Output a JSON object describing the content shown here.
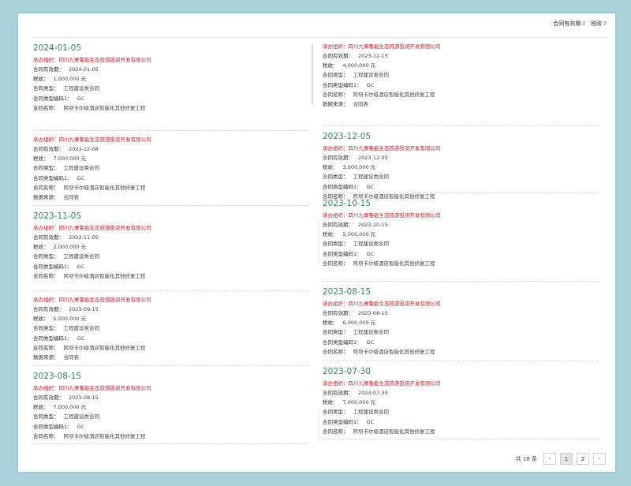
{
  "sort": {
    "items": [
      {
        "label": "合同有效期",
        "arrow": "⇵"
      },
      {
        "label": "税收",
        "arrow": "⇵"
      }
    ]
  },
  "labels": {
    "org": "承办组织：",
    "valid": "合同有效期：",
    "tax": "税收：",
    "type": "合同类型：",
    "code": "合同类型编码1：",
    "name": "合同名称：",
    "source": "数据来源："
  },
  "left": [
    {
      "date": "2024-01-05",
      "org": "四川九寨鲁能生态旅游投资开发有限公司",
      "valid": "2024-01-05",
      "tax": "1,000,000 元",
      "type": "工程建设类合同",
      "code": "GC",
      "name": "阿坝卡尔级酒店智能化其他修复工程",
      "source": ""
    },
    {
      "date": "",
      "org": "四川九寨鲁能生态旅游投资开发有限公司",
      "valid": "2023-12-08",
      "tax": "7,000,000 元",
      "type": "工程建设类合同",
      "code": "GC",
      "name": "阿坝卡尔级酒店智能化其他修复工程",
      "source": "合同表"
    },
    {
      "date": "2023-11-05",
      "org": "四川九寨鲁能生态旅游投资开发有限公司",
      "valid": "2023-11-05",
      "tax": "2,000,000 元",
      "type": "工程建设类合同",
      "code": "GC",
      "name": "阿坝卡尔级酒店智能化其他修复工程",
      "source": ""
    },
    {
      "date": "",
      "org": "四川九寨鲁能生态旅游投资开发有限公司",
      "valid": "2023-09-15",
      "tax": "5,000,000 元",
      "type": "工程建设类合同",
      "code": "GC",
      "name": "阿坝卡尔级酒店智能化其他修复工程",
      "source": "合同表"
    },
    {
      "date": "2023-08-15",
      "org": "四川九寨鲁能生态旅游投资开发有限公司",
      "valid": "2023-08-15",
      "tax": "7,000,000 元",
      "type": "工程建设类合同",
      "code": "GC",
      "name": "阿坝卡尔级酒店智能化其他修复工程",
      "source": ""
    }
  ],
  "right": [
    {
      "date": "",
      "org": "四川九寨鲁能生态旅游投资开发有限公司",
      "valid": "2023-12-15",
      "tax": "4,000,000 元",
      "type": "工程建设类合同",
      "code": "GC",
      "name": "阿坝卡尔级酒店智能化其他修复工程",
      "source": "合同表"
    },
    {
      "date": "2023-12-05",
      "org": "四川九寨鲁能生态旅游投资开发有限公司",
      "valid": "2023-12-05",
      "tax": "3,000,000 元",
      "type": "工程建设类合同",
      "code": "GC",
      "name": "阿坝卡尔级酒店智能化其他修复工程",
      "source": ""
    },
    {
      "date": "2023-10-15",
      "org": "四川九寨鲁能生态旅游投资开发有限公司",
      "valid": "2023-10-15",
      "tax": "5,000,000 元",
      "type": "工程建设类合同",
      "code": "GC",
      "name": "阿坝卡尔级酒店智能化其他修复工程",
      "source": ""
    },
    {
      "date": "2023-08-15",
      "org": "四川九寨鲁能生态旅游投资开发有限公司",
      "valid": "2023-08-15",
      "tax": "6,000,000 元",
      "type": "工程建设类合同",
      "code": "GC",
      "name": "阿坝卡尔级酒店智能化其他修复工程",
      "source": ""
    },
    {
      "date": "2023-07-30",
      "org": "四川九寨鲁能生态旅游投资开发有限公司",
      "valid": "2023-07-30",
      "tax": "7,000,000 元",
      "type": "工程建设类合同",
      "code": "GC",
      "name": "阿坝卡尔级酒店智能化其他修复工程",
      "source": ""
    }
  ],
  "pager": {
    "total": "共 18 条",
    "prev": "‹",
    "next": "›",
    "pages": [
      "1",
      "2"
    ],
    "current": "1"
  }
}
